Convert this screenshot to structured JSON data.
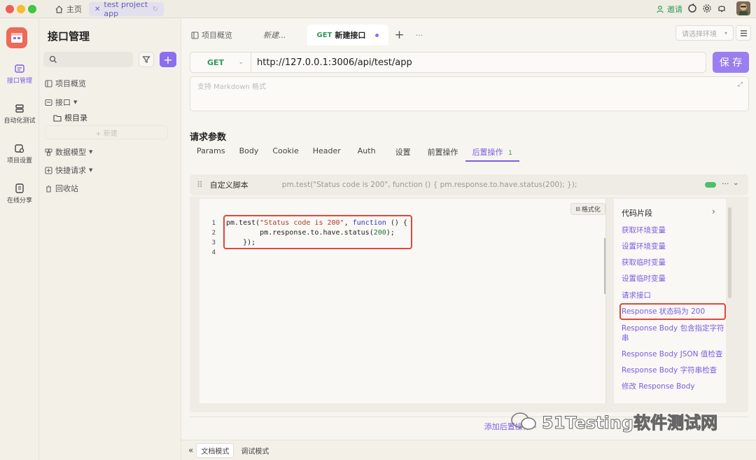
{
  "titlebar": {
    "home_label": "主页",
    "project_tab": "test project app",
    "invite_label": "邀请"
  },
  "rail": {
    "items": [
      {
        "label": "接口管理",
        "icon": "api-icon",
        "active": true
      },
      {
        "label": "自动化测试",
        "icon": "automation-icon",
        "active": false
      },
      {
        "label": "项目设置",
        "icon": "settings-icon",
        "active": false
      },
      {
        "label": "在线分享",
        "icon": "share-icon",
        "active": false
      }
    ]
  },
  "sidebar": {
    "title": "接口管理",
    "items": [
      {
        "label": "项目概览"
      },
      {
        "label": "接口"
      },
      {
        "label": "根目录"
      },
      {
        "label": "+ 新建"
      },
      {
        "label": "数据模型"
      },
      {
        "label": "快捷请求"
      },
      {
        "label": "回收站"
      }
    ]
  },
  "tabs": {
    "overview": "项目概览",
    "new_tab": "新建...",
    "active_method": "GET",
    "active_label": "新建接口"
  },
  "env_placeholder": "请选择环境",
  "request": {
    "method": "GET",
    "url": "http://127.0.0.1:3006/api/test/app",
    "save_label": "保 存",
    "markdown_placeholder": "支持 Markdown 格式"
  },
  "params": {
    "title": "请求参数",
    "tabs": [
      "Params",
      "Body",
      "Cookie",
      "Header",
      "Auth",
      "设置",
      "前置操作",
      "后置操作"
    ],
    "post_count": "1"
  },
  "script": {
    "name": "自定义脚本",
    "preview": "pm.test(\"Status code is 200\", function () { pm.response.to.have.status(200); });",
    "format_label": "格式化",
    "line_numbers": [
      "1",
      "2",
      "3",
      "4"
    ]
  },
  "snippets": {
    "title": "代码片段",
    "items": [
      "获取环境变量",
      "设置环境变量",
      "获取临时变量",
      "设置临时变量",
      "请求接口",
      "Response 状态码为 200",
      "Response Body 包含指定字符串",
      "Response Body JSON 值检查",
      "Response Body 字符串检查",
      "修改 Response Body"
    ]
  },
  "add_post_label": "添加后置操作",
  "bottom": {
    "doc_mode": "文档模式",
    "debug_mode": "调试模式"
  },
  "watermark": "51Testing软件测试网",
  "colors": {
    "accent": "#7b5ce6",
    "get": "#2f9a5a",
    "highlight": "#e0473f"
  }
}
